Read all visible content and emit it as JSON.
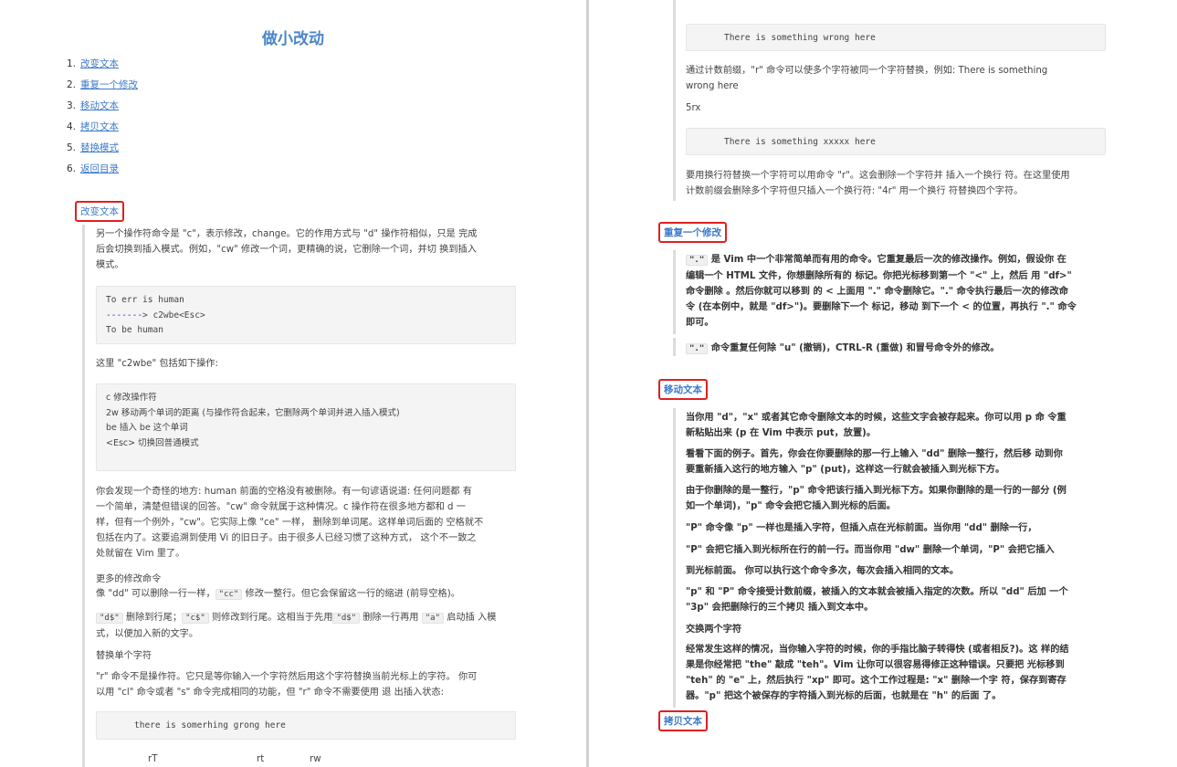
{
  "left": {
    "title": "做小改动",
    "toc": [
      {
        "num": "1.",
        "label": "改变文本"
      },
      {
        "num": "2.",
        "label": "重复一个修改"
      },
      {
        "num": "3.",
        "label": "移动文本"
      },
      {
        "num": "4.",
        "label": "拷贝文本"
      },
      {
        "num": "5.",
        "label": "替换模式"
      },
      {
        "num": "6.",
        "label": "返回目录"
      }
    ],
    "h_change": "改变文本",
    "intro": [
      "另一个操作符命令是 \"c\"，表示修改，change。它的作用方式与 \"d\" 操作符相似，只是 完成",
      "后会切换到插入模式。例如，\"cw\" 修改一个词，更精确的说，它删除一个词，并切 换到插入",
      "模式。"
    ],
    "code1": {
      "l1": "To err is human",
      "dash": "-------",
      "l2": "> c2wbe<Esc>",
      "l3": "To be human"
    },
    "c2wbe_intro": "这里 \"c2wbe\" 包括如下操作:",
    "code2": [
      "c 修改操作符",
      "2w 移动两个单词的距离 (与操作符合起来，它删除两个单词并进入插入模式)",
      "be 插入 be 这个单词",
      "<Esc> 切换回普通模式"
    ],
    "odd": [
      "你会发现一个奇怪的地方: human 前面的空格没有被删除。有一句谚语说道: 任何问题都 有",
      "一个简单，清楚但错误的回答。\"cw\" 命令就属于这种情况。c 操作符在很多地方都和 d 一",
      "样，但有一个例外，\"cw\"。它实际上像 \"ce\" 一样， 删除到单词尾。这样单词后面的 空格就不",
      "包括在内了。这要追溯到使用 Vi 的旧日子。由于很多人已经习惯了这种方式， 这个不一致之",
      "处就留在 Vim 里了。"
    ],
    "more_title": "更多的修改命令",
    "dd_pre": "像 \"dd\" 可以删除一行一样，",
    "dd_code": "\"cc\"",
    "dd_post": " 修改一整行。但它会保留这一行的缩进 (前导空格)。",
    "d_code": "\"d$\"",
    "d_mid1": " 删除到行尾；",
    "c_code": "\"c$\"",
    "d_mid2": " 则修改到行尾。这相当于先用",
    "d_code2": "\"d$\"",
    "d_mid3": " 删除一行再用 ",
    "a_code": "\"a\"",
    "d_post": " 启动插 入模",
    "d_line2": "式，以便加入新的文字。",
    "replace_title": "替换单个字符",
    "r_desc": [
      "\"r\" 命令不是操作符。它只是等你输入一个字符然后用这个字符替换当前光标上的字符。 你可",
      "以用 \"cl\" 命令或者 \"s\" 命令完成相同的功能，但 \"r\" 命令不需要使用  退 出插入状态:"
    ],
    "code3": "there is somerhing grong here",
    "bottom_row": [
      "rT",
      "rt",
      "rw"
    ]
  },
  "right": {
    "code_top": "There is something wrong here",
    "count_text": [
      "通过计数前缀，\"r\" 命令可以使多个字符被同一个字符替换，例如: There is something",
      "wrong here"
    ],
    "five_rx": "5rx",
    "code_five": "There is something xxxxx here",
    "newline_text": [
      "要用换行符替换一个字符可以用命令 \"r\"。这会删除一个字符并 插入一个换行 符。在这里使用",
      "计数前缀会删除多个字符但只插入一个换行符: \"4r\" 用一个换行 符替换四个字符。"
    ],
    "h_repeat": "重复一个修改",
    "dot_code": "\".\"",
    "dot_text": [
      " 是 Vim 中一个非常简单而有用的命令。它重复最后一次的修改操作。例如，假设你 在",
      "编辑一个 HTML 文件，你想删除所有的  标记。你把光标移到第一个 \"<\" 上，然后 用 \"df>\"",
      "命令删除 。然后你就可以移到  的 < 上面用 \".\" 命令删除它。\".\" 命令执行最后一次的修改命",
      "令 (在本例中，就是 \"df>\")。要删除下一个  标记，移动 到下一个 < 的位置，再执行 \".\" 命令",
      "即可。"
    ],
    "dot_code2": "\".\"",
    "dot_repeat": " 命令重复任何除 \"u\" (撤销)，CTRL-R (重做) 和冒号命令外的修改。",
    "h_move": "移动文本",
    "move_paras": [
      [
        "当你用 \"d\"，\"x\" 或者其它命令删除文本的时候，这些文字会被存起来。你可以用 p 命 令重",
        "新粘贴出来 (p 在 Vim 中表示 put，放置)。"
      ],
      [
        "看看下面的例子。首先，你会在你要删除的那一行上输入 \"dd\" 删除一整行，然后移 动到你",
        "要重新插入这行的地方输入 \"p\" (put)，这样这一行就会被插入到光标下方。"
      ],
      [
        "由于你删除的是一整行，\"p\" 命令把该行插入到光标下方。如果你删除的是一行的一部分 (例",
        "如一个单词)，\"p\" 命令会把它插入到光标的后面。"
      ],
      [
        "\"P\" 命令像 \"p\" 一样也是插入字符，但插入点在光标前面。当你用 \"dd\" 删除一行，"
      ],
      [
        "\"P\" 会把它插入到光标所在行的前一行。而当你用 \"dw\" 删除一个单词，\"P\" 会把它插入"
      ],
      [
        "到光标前面。 你可以执行这个命令多次，每次会插入相同的文本。"
      ],
      [
        "\"p\" 和 \"P\" 命令接受计数前缀，被插入的文本就会被插入指定的次数。所以 \"dd\" 后加 一个",
        "\"3p\" 会把删除行的三个拷贝 插入到文本中。"
      ],
      [
        "交换两个字符"
      ],
      [
        "经常发生这样的情况，当你输入字符的时候，你的手指比脑子转得快 (或者相反?)。这 样的结",
        "果是你经常把 \"the\" 敲成 \"teh\"。Vim 让你可以很容易得修正这种错误。只要把 光标移到",
        "\"teh\" 的 \"e\" 上，然后执行 \"xp\" 即可。这个工作过程是: \"x\" 删除一个字 符，保存到寄存",
        "器。\"p\" 把这个被保存的字符插入到光标的后面，也就是在 \"h\" 的后面 了。"
      ]
    ],
    "h_copy": "拷贝文本"
  }
}
